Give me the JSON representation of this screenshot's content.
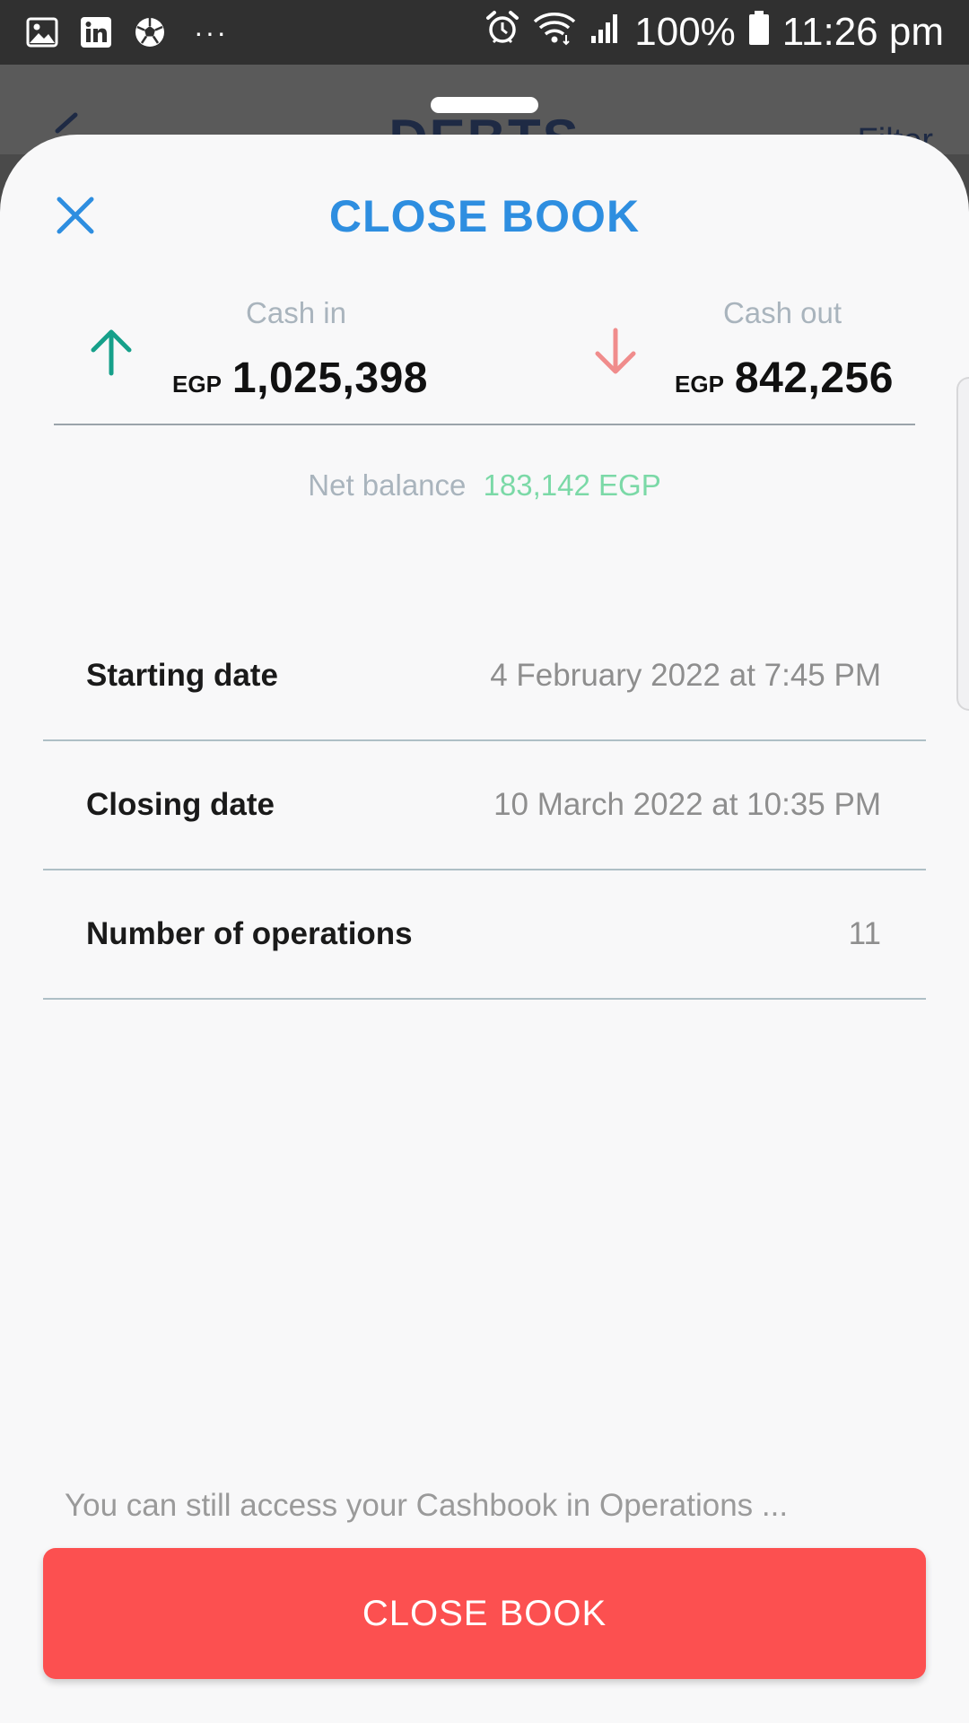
{
  "status_bar": {
    "left_icons": [
      "gallery-icon",
      "linkedin-icon",
      "soccer-ball-icon"
    ],
    "more": "···",
    "battery_percent": "100%",
    "time": "11:26 pm"
  },
  "background_screen": {
    "title": "DEBTS",
    "filter_label": "Filter"
  },
  "sheet": {
    "title": "CLOSE BOOK",
    "cash_in": {
      "label": "Cash in",
      "currency": "EGP",
      "amount": "1,025,398"
    },
    "cash_out": {
      "label": "Cash out",
      "currency": "EGP",
      "amount": "842,256"
    },
    "net_balance": {
      "label": "Net balance",
      "value": "183,142 EGP"
    },
    "rows": [
      {
        "label": "Starting date",
        "value": "4 February 2022 at 7:45 PM"
      },
      {
        "label": "Closing date",
        "value": "10 March 2022 at 10:35 PM"
      },
      {
        "label": "Number of operations",
        "value": "11"
      }
    ],
    "hint": "You can still access your Cashbook in Operations ...",
    "button_label": "CLOSE BOOK"
  },
  "colors": {
    "accent_blue": "#2e8ee0",
    "cash_in_green": "#16a08a",
    "cash_out_red": "#f08c8c",
    "net_balance_green": "#7bd9a7",
    "button_red": "#fc5050"
  }
}
